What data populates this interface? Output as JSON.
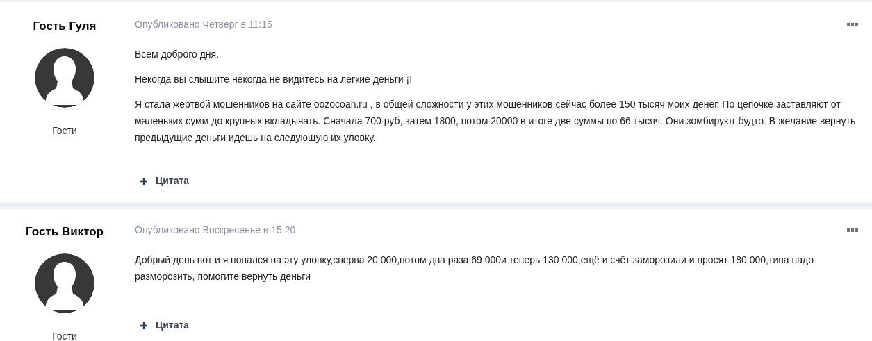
{
  "posts": [
    {
      "author": "Гость Гуля",
      "group": "Гости",
      "posted": "Опубликовано Четверг в 11:15",
      "paragraphs": [
        "Всем доброго дня.",
        "Некогда вы слышите некогда не видитесь на легкие деньги ¡!",
        "Я стала жертвой мошенников на сайте oozocoan.ru , в общей сложности у этих мошенников сейчас более 150 тысяч моих денег. По цепочке заставляют от маленьких сумм до крупных вкладывать. Сначала 700 руб, затем 1800, потом 20000 в итоге две суммы по 66 тысяч. Они зомбируют будто. В желание вернуть предыдущие деньги идешь на следующую их уловку."
      ],
      "quote": "Цитата"
    },
    {
      "author": "Гость Виктор",
      "group": "Гости",
      "posted": "Опубликовано Воскресенье в 15:20",
      "paragraphs": [
        "Добрый день вот и я попался на эту уловку,сперва 20 000,потом два раза 69 000и теперь 130 000,ещё и счёт заморозили и просят 180 000,типа надо разморозить, помогите вернуть деньги"
      ],
      "quote": "Цитата"
    }
  ]
}
